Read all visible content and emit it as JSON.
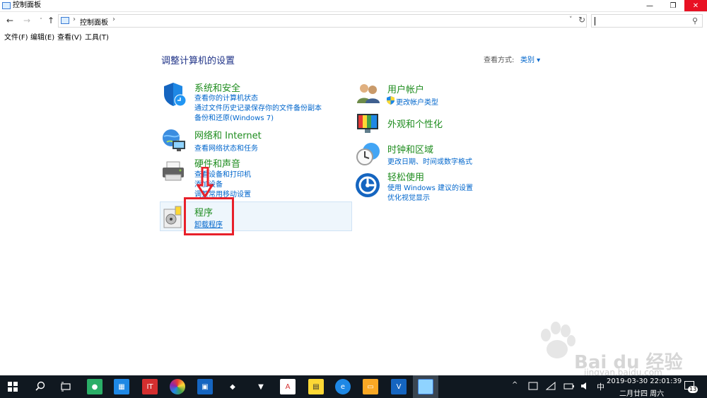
{
  "window": {
    "title": "控制面板",
    "minimize": "—",
    "maximize": "❐",
    "close": "✕"
  },
  "address": {
    "back": "←",
    "forward": "→",
    "recent": "˅",
    "up": "↑",
    "sep": "›",
    "crumb": "控制面板",
    "dropdown": "˅",
    "refresh": "↻",
    "search_placeholder": "",
    "search_icon": "⚲"
  },
  "menu": {
    "file": "文件(F)",
    "edit": "编辑(E)",
    "view": "查看(V)",
    "tools": "工具(T)"
  },
  "content": {
    "heading": "调整计算机的设置",
    "view_by_label": "查看方式:",
    "view_by_value": "类别 ▾",
    "left": [
      {
        "title": "系统和安全",
        "links": [
          "查看你的计算机状态",
          "通过文件历史记录保存你的文件备份副本",
          "备份和还原(Windows 7)"
        ]
      },
      {
        "title": "网络和 Internet",
        "links": [
          "查看网络状态和任务"
        ]
      },
      {
        "title": "硬件和声音",
        "links": [
          "查看设备和打印机",
          "添加设备",
          "调整常用移动设置"
        ]
      },
      {
        "title": "程序",
        "links": [
          "卸载程序"
        ]
      }
    ],
    "right": [
      {
        "title": "用户帐户",
        "links": [
          "更改帐户类型"
        ]
      },
      {
        "title": "外观和个性化",
        "links": []
      },
      {
        "title": "时钟和区域",
        "links": [
          "更改日期、时间或数字格式"
        ]
      },
      {
        "title": "轻松使用",
        "links": [
          "使用 Windows 建议的设置",
          "优化视觉显示"
        ]
      }
    ]
  },
  "watermark": {
    "text": "Bai du 经验",
    "url": "jingyan.baidu.com"
  },
  "taskbar": {
    "tray_chevron": "^",
    "ime": "中",
    "time": "2019-03-30  22:01:39",
    "date": "二月廿四 周六",
    "notifications": "13"
  },
  "colors": {
    "accent": "#0066cc",
    "category_green": "#1e8c1e",
    "heading_blue": "#1e3287",
    "highlight_red": "#e8202a",
    "taskbar": "#101820"
  }
}
